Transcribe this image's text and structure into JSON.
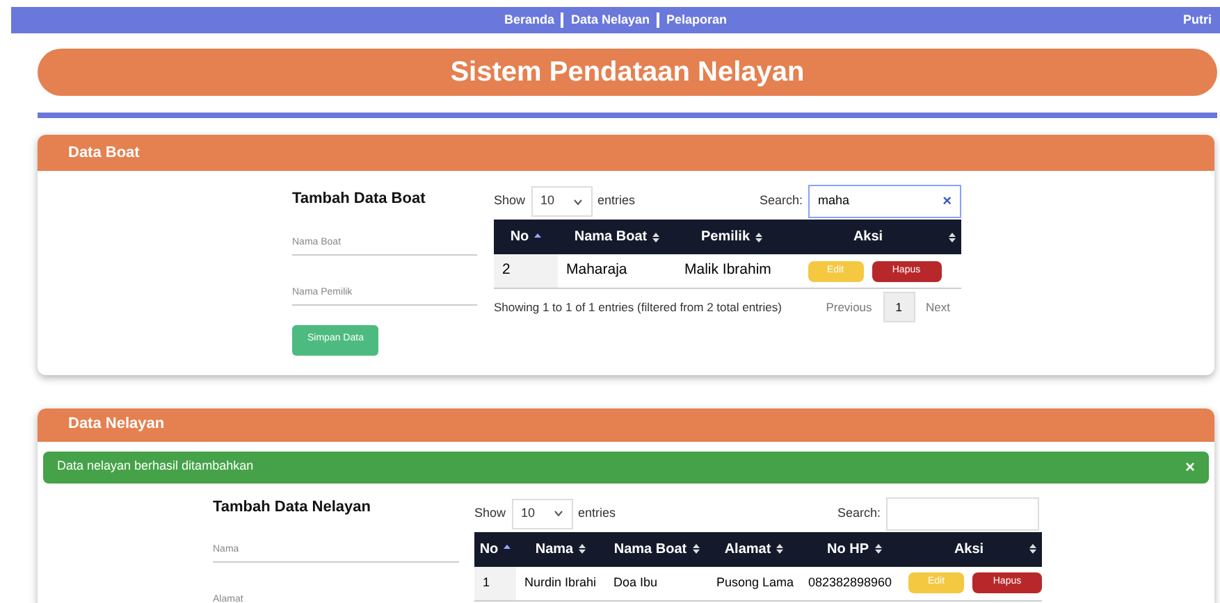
{
  "nav": {
    "links": [
      {
        "label": "Beranda"
      },
      {
        "label": "Data Nelayan"
      },
      {
        "label": "Pelaporan"
      }
    ],
    "user": "Putri"
  },
  "banner": {
    "title": "Sistem Pendataan Nelayan"
  },
  "boat_card": {
    "title": "Data Boat",
    "form": {
      "title": "Tambah Data Boat",
      "fields": [
        {
          "placeholder": "Nama Boat"
        },
        {
          "placeholder": "Nama Pemilik"
        }
      ],
      "submit": "Simpan Data"
    },
    "table": {
      "show": "Show",
      "length": "10",
      "entries": "entries",
      "search_label": "Search:",
      "search_value": "maha",
      "clear": "×",
      "columns": [
        {
          "label": "No",
          "sorted": true
        },
        {
          "label": "Nama Boat",
          "sorted": false
        },
        {
          "label": "Pemilik",
          "sorted": false
        },
        {
          "label": "Aksi",
          "sorted": false
        }
      ],
      "rows": [
        {
          "cells": [
            "2",
            "Maharaja",
            "Malik Ibrahim"
          ],
          "edit": "Edit",
          "delete": "Hapus"
        }
      ],
      "info": "Showing 1 to 1 of 1 entries (filtered from 2 total entries)",
      "pagination": [
        {
          "label": "Previous",
          "selected": false
        },
        {
          "label": "1",
          "selected": true
        },
        {
          "label": "Next",
          "selected": false
        }
      ]
    }
  },
  "nelayan_card": {
    "title": "Data Nelayan",
    "alert": {
      "message": "Data nelayan berhasil ditambahkan",
      "close": "×"
    },
    "form": {
      "title": "Tambah Data Nelayan",
      "fields": [
        {
          "placeholder": "Nama"
        },
        {
          "placeholder": "Alamat"
        }
      ]
    },
    "table": {
      "show": "Show",
      "length": "10",
      "entries": "entries",
      "search_label": "Search:",
      "columns": [
        {
          "label": "No",
          "sorted": true
        },
        {
          "label": "Nama",
          "sorted": false
        },
        {
          "label": "Nama Boat",
          "sorted": false
        },
        {
          "label": "Alamat",
          "sorted": false
        },
        {
          "label": "No HP",
          "sorted": false
        },
        {
          "label": "Aksi",
          "sorted": false
        }
      ],
      "rows": [
        {
          "cells": [
            "1",
            "Nurdin Ibrahi",
            "Doa Ibu",
            "Pusong Lama",
            "082382898960"
          ],
          "edit": "Edit",
          "delete": "Hapus"
        }
      ]
    }
  }
}
